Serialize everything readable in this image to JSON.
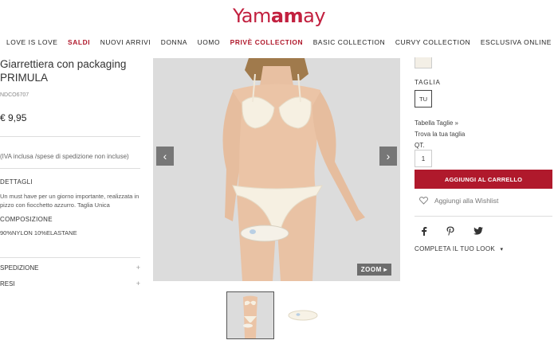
{
  "brand": {
    "logo_text": "Yamamay",
    "logo_pre": "Yam",
    "logo_mid": "am",
    "logo_post": "ay"
  },
  "nav": {
    "items": [
      {
        "label": "LOVE IS LOVE",
        "highlight": false
      },
      {
        "label": "SALDI",
        "highlight": true
      },
      {
        "label": "NUOVI ARRIVI",
        "highlight": false
      },
      {
        "label": "DONNA",
        "highlight": false
      },
      {
        "label": "UOMO",
        "highlight": false
      },
      {
        "label": "PRIVÈ COLLECTION",
        "highlight": true
      },
      {
        "label": "BASIC COLLECTION",
        "highlight": false
      },
      {
        "label": "CURVY COLLECTION",
        "highlight": false
      },
      {
        "label": "ESCLUSIVA ONLINE",
        "highlight": false
      }
    ]
  },
  "product": {
    "title": "Giarrettiera con packaging PRIMULA",
    "sku": "NDCO6707",
    "price": "€ 9,95",
    "vat_note": "(IVA inclusa /spese di spedizione non incluse)",
    "details_heading": "DETTAGLI",
    "description": "Un must have per un giorno importante, realizzata in pizzo con fiocchetto azzurro. Taglia Unica",
    "composition_heading": "COMPOSIZIONE",
    "composition": "90%NYLON 10%ELASTANE",
    "accordions": [
      {
        "label": "SPEDIZIONE",
        "icon": "+"
      },
      {
        "label": "RESI",
        "icon": "+"
      }
    ]
  },
  "gallery": {
    "prev_icon": "‹",
    "next_icon": "›",
    "zoom_label": "ZOOM",
    "zoom_icon": "▸"
  },
  "purchase": {
    "size_label": "TAGLIA",
    "size_value": "TU",
    "size_chart_link": "Tabella Taglie »",
    "find_size_link": "Trova la tua taglia",
    "qty_label": "QT.",
    "qty_value": "1",
    "add_to_cart": "AGGIUNGI AL CARRELLO",
    "wishlist": "Aggiungi alla Wishlist",
    "complete_look": "COMPLETA IL TUO LOOK",
    "complete_look_icon": "▾"
  },
  "colors": {
    "brand_red": "#b0192c",
    "logo_red": "#c2203f",
    "swatch": "#f3efe6"
  }
}
